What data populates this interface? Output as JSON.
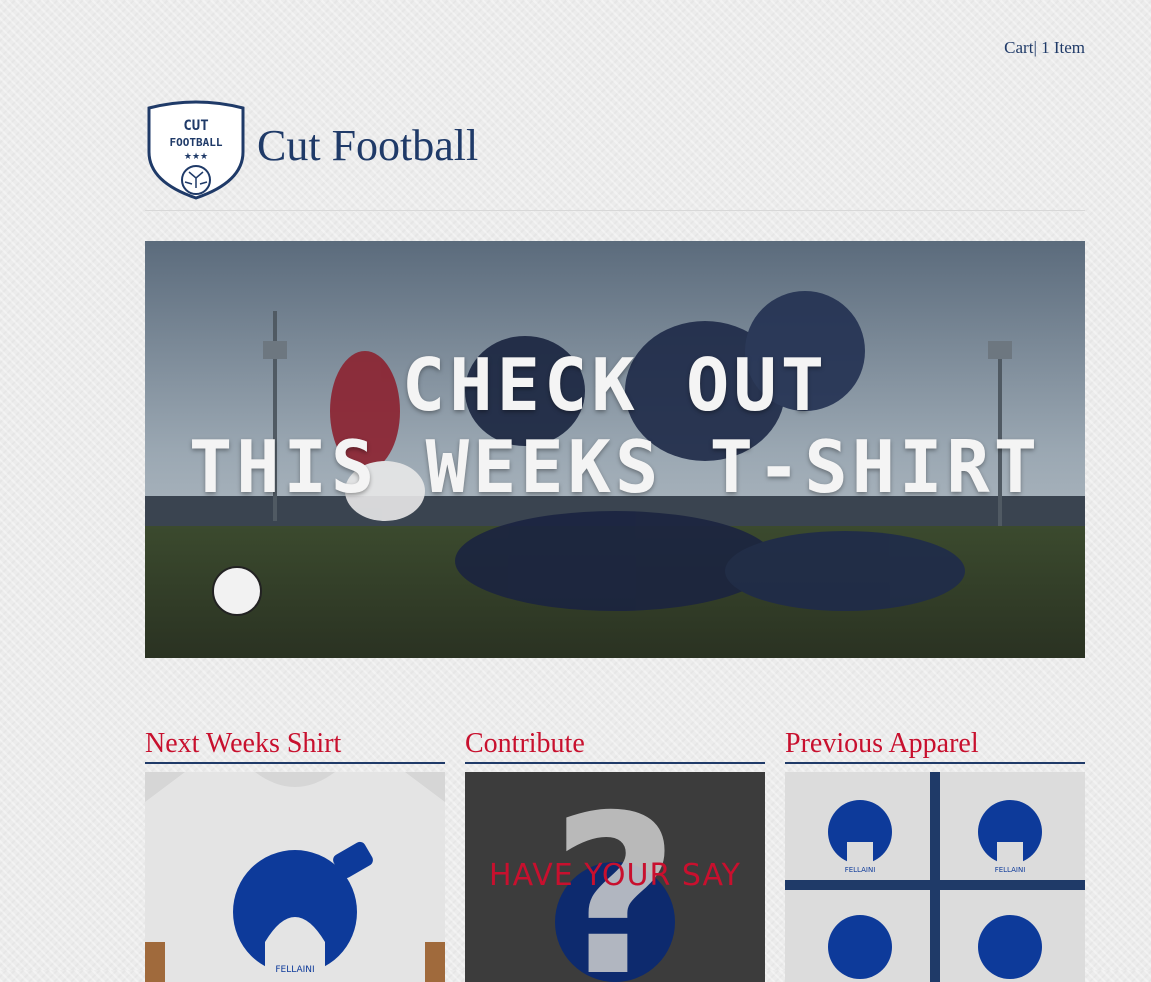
{
  "cart": {
    "label": "Cart",
    "separator": "|",
    "count_label": "1 Item"
  },
  "header": {
    "site_title": "Cut Football",
    "logo": {
      "line1": "CUT",
      "line2": "FOOTBALL",
      "stars": "★★★"
    }
  },
  "hero": {
    "line1": "CHECK OUT",
    "line2": "THIS WEEKS T-SHIRT"
  },
  "columns": [
    {
      "title": "Next Weeks Shirt",
      "image_caption": "FELLAINI"
    },
    {
      "title": "Contribute",
      "overlay_text": "HAVE YOUR SAY"
    },
    {
      "title": "Previous Apparel",
      "image_caption": "FELLAINI"
    }
  ],
  "colors": {
    "navy": "#1f3a68",
    "red": "#c8102e",
    "shirt_blue": "#0d3a9a"
  }
}
